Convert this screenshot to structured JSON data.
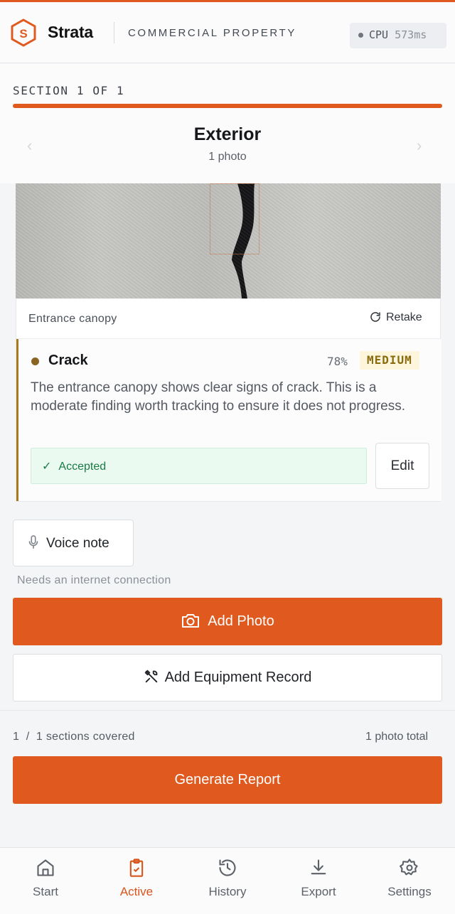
{
  "app": {
    "brand": "Strata",
    "subtitle": "COMMERCIAL PROPERTY",
    "cpu_label": "CPU",
    "cpu_value": "573ms",
    "accent_color": "#e05a1f"
  },
  "section": {
    "label": "SECTION 1 OF 1",
    "progress_fraction": 1.0,
    "title": "Exterior",
    "photo_count": "1 photo",
    "prev_icon": "chevron-left-icon",
    "next_icon": "chevron-right-icon"
  },
  "photo_card": {
    "caption": "Entrance canopy",
    "retake_label": "Retake",
    "finding": {
      "title": "Crack",
      "confidence": "78%",
      "severity": "MEDIUM",
      "severity_color": "#8a6b0e",
      "description": "The entrance canopy shows clear signs of crack. This is a moderate finding worth tracking to ensure it does not progress.",
      "status": "Accepted",
      "edit_label": "Edit"
    }
  },
  "voice_note": {
    "label": "Voice note",
    "hint": "Needs an internet connection"
  },
  "actions": {
    "add_photo": "Add Photo",
    "add_equipment": "Add Equipment Record",
    "generate_report": "Generate Report"
  },
  "summary": {
    "sections_covered": "1  /  1 sections covered",
    "photo_total": "1 photo total"
  },
  "tabs": [
    {
      "label": "Start",
      "icon": "home-icon"
    },
    {
      "label": "Active",
      "icon": "clipboard-check-icon",
      "active": true
    },
    {
      "label": "History",
      "icon": "history-icon"
    },
    {
      "label": "Export",
      "icon": "download-icon"
    },
    {
      "label": "Settings",
      "icon": "gear-icon"
    }
  ]
}
